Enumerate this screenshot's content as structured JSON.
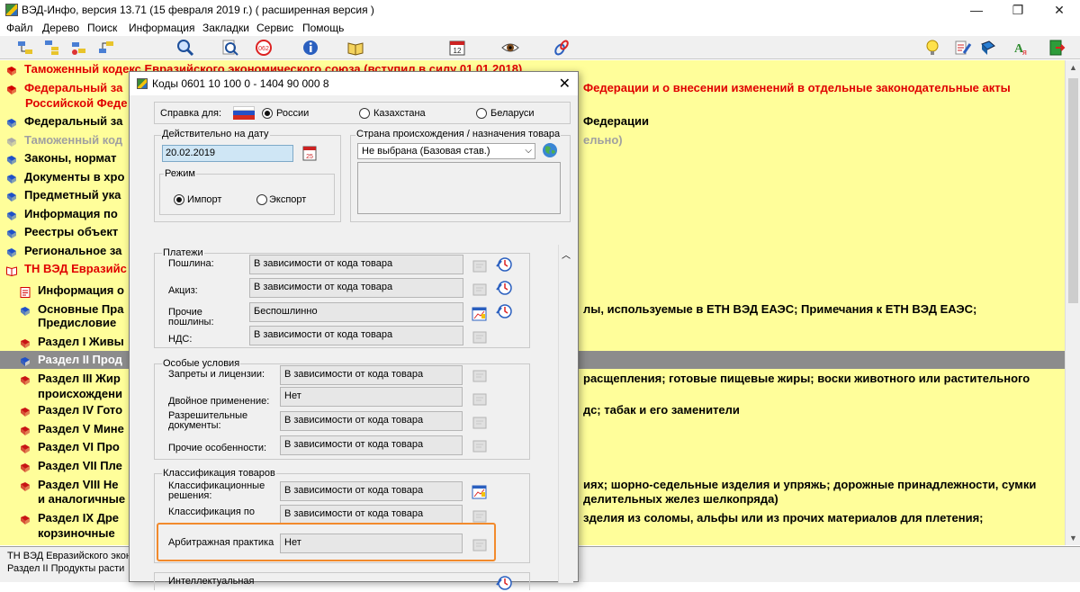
{
  "window": {
    "title": "ВЭД-Инфо, версия 13.71 (15 февраля 2019 г.)  ( расширенная версия )",
    "btn_minimize": "—",
    "btn_restore": "❐",
    "btn_close": "✕"
  },
  "menu": [
    "Файл",
    "Дерево",
    "Поиск",
    "Информация",
    "Закладки",
    "Сервис",
    "Помощь"
  ],
  "toolbar_icons": [
    "tree-nav-icon",
    "tree-expand-icon",
    "tree-collapse-icon",
    "tree-up-icon",
    "search-icon",
    "search-doc-icon",
    "stop-icon",
    "info-icon",
    "book-icon",
    "calendar-icon",
    "eye-icon",
    "link-icon",
    "bulb-icon",
    "doc-pen-icon",
    "font-icon",
    "exit-icon"
  ],
  "tree": {
    "rows": [
      {
        "text": "Таможенный кодекс Евразийского экономического союза (вступил в силу 01.01.2018)",
        "cont": "",
        "style": "red"
      },
      {
        "text": "Федеральный за",
        "cont": "Федерации и о внесении изменений в отдельные законодательные акты",
        "style": "red"
      },
      {
        "text": "Российской Феде",
        "cont": "",
        "style": "red"
      },
      {
        "text": "Федеральный за",
        "cont": "Федерации",
        "style": "black"
      },
      {
        "text": "Таможенный код",
        "cont": "ельно)",
        "style": "gray"
      },
      {
        "text": "Законы, нормат",
        "cont": "",
        "style": "black"
      },
      {
        "text": "Документы в хро",
        "cont": "",
        "style": "black"
      },
      {
        "text": "Предметный ука",
        "cont": "",
        "style": "black"
      },
      {
        "text": "Информация по",
        "cont": "",
        "style": "black"
      },
      {
        "text": "Реестры объект",
        "cont": "",
        "style": "black"
      },
      {
        "text": "Региональное за",
        "cont": "",
        "style": "black"
      },
      {
        "text": "ТН ВЭД Евразийс",
        "cont": "",
        "style": "red"
      },
      {
        "text": "Информация о",
        "cont": "",
        "style": "black"
      },
      {
        "text": "Основные Пра",
        "cont": "лы, используемые в ЕТН ВЭД ЕАЭС; Примечания к ЕТН ВЭД ЕАЭС;",
        "style": "black"
      },
      {
        "text": "Предисловие",
        "cont": "",
        "style": "black"
      },
      {
        "text": "Раздел I Живы",
        "cont": "",
        "style": "black"
      },
      {
        "text": "Раздел II Прод",
        "cont": "",
        "style": "selected"
      },
      {
        "text": "Раздел III Жир",
        "cont": "расщепления; готовые пищевые жиры; воски животного или растительного",
        "style": "black"
      },
      {
        "text": "происхождени",
        "cont": "",
        "style": "black"
      },
      {
        "text": "Раздел IV Гото",
        "cont": "дс; табак и его заменители",
        "style": "black"
      },
      {
        "text": "Раздел V Мине",
        "cont": "",
        "style": "black"
      },
      {
        "text": "Раздел VI Про",
        "cont": "",
        "style": "black"
      },
      {
        "text": "Раздел VII Пле",
        "cont": "",
        "style": "black"
      },
      {
        "text": "Раздел VIII Не",
        "cont": "иях; шорно-седельные изделия и упряжь; дорожные принадлежности, сумки",
        "style": "black"
      },
      {
        "text": "и аналогичные",
        "cont": "делительных желез шелкопряда)",
        "style": "black"
      },
      {
        "text": "Раздел IX Дре",
        "cont": "зделия из соломы, альфы или из прочих материалов для плетения;",
        "style": "black"
      },
      {
        "text": "корзиночные",
        "cont": "",
        "style": "black"
      }
    ]
  },
  "status": {
    "line1": "ТН ВЭД Евразийского экон",
    "line2": "Раздел II Продукты расти"
  },
  "dialog": {
    "title": "Коды 0601 10 100 0 - 1404 90 000 8",
    "close": "✕",
    "reference_for_label": "Справка для:",
    "countries": [
      {
        "label": "России",
        "selected": true
      },
      {
        "label": "Казахстана",
        "selected": false
      },
      {
        "label": "Беларуси",
        "selected": false
      }
    ],
    "date_group_label": "Действительно на дату",
    "date_value": "20.02.2019",
    "mode_group_label": "Режим",
    "modes": [
      {
        "label": "Импорт",
        "selected": true
      },
      {
        "label": "Экспорт",
        "selected": false
      }
    ],
    "origin_group_label": "Страна происхождения / назначения товара",
    "origin_value": "Не выбрана (Базовая став.)",
    "payments": {
      "label": "Платежи",
      "rows": [
        {
          "label": "Пошлина:",
          "value": "В зависимости от кода товара"
        },
        {
          "label": "Акциз:",
          "value": "В зависимости от кода товара"
        },
        {
          "label": "Прочие\nпошлины:",
          "value": "Беспошлинно"
        },
        {
          "label": "НДС:",
          "value": "В зависимости от кода товара"
        }
      ]
    },
    "special": {
      "label": "Особые условия",
      "rows": [
        {
          "label": "Запреты и лицензии:",
          "value": "В зависимости от кода товара"
        },
        {
          "label": "Двойное применение:",
          "value": "Нет"
        },
        {
          "label": "Разрешительные\nдокументы:",
          "value": "В зависимости от кода товара"
        },
        {
          "label": "Прочие особенности:",
          "value": "В зависимости от кода товара"
        }
      ]
    },
    "classification": {
      "label": "Классификация товаров",
      "rows": [
        {
          "label": "Классификационные\nрешения:",
          "value": "В зависимости от кода товара"
        },
        {
          "label": "Классификация по\nдокументам:",
          "value": "В зависимости от кода товара"
        },
        {
          "label": "Арбитражная практика",
          "value": "Нет"
        }
      ]
    },
    "intellectual_label": "Интеллектуальная"
  }
}
